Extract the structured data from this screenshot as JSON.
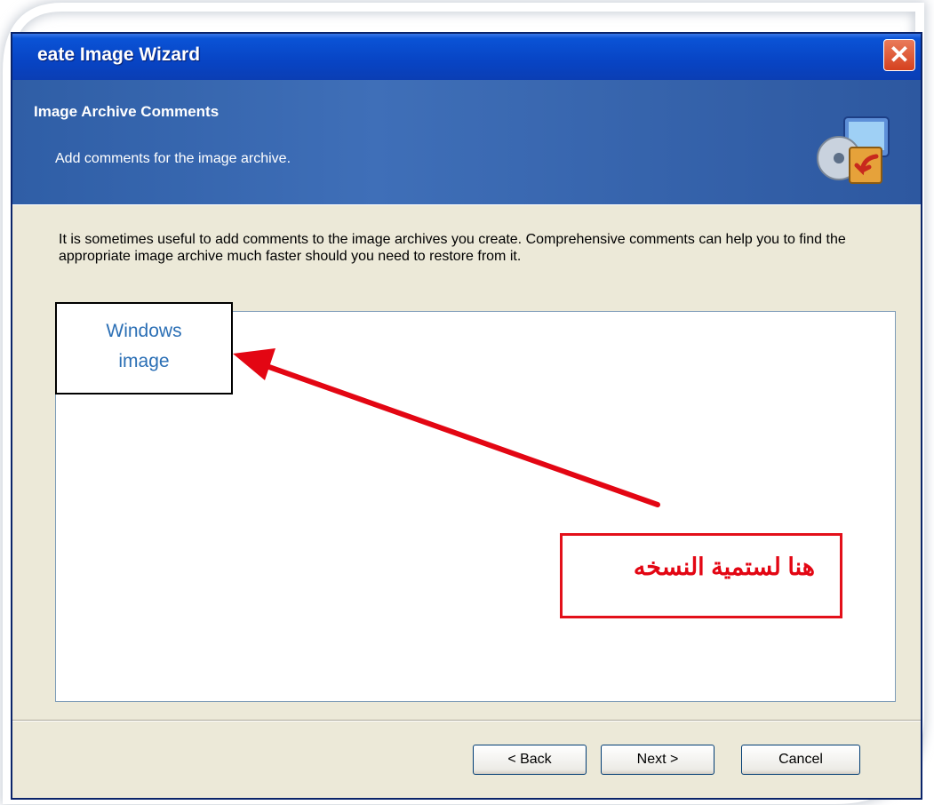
{
  "window": {
    "title": "eate Image Wizard",
    "close_symbol": "✕"
  },
  "banner": {
    "heading": "Image Archive Comments",
    "subheading": "Add comments for the image archive.",
    "icon": "wizard-monitor-disc-icon"
  },
  "body": {
    "intro_text": "It is sometimes useful to add comments to the image archives you create. Comprehensive comments can help you to find the appropriate image archive much faster should you need to restore from it.",
    "comment_value": ""
  },
  "buttons": {
    "back": "< Back",
    "next": "Next >",
    "cancel": "Cancel"
  },
  "annotations": {
    "box_line1": "Windows",
    "box_line2": "image",
    "arabic_note": "هنا لستمية النسخه",
    "arrow_color": "#e30613"
  }
}
